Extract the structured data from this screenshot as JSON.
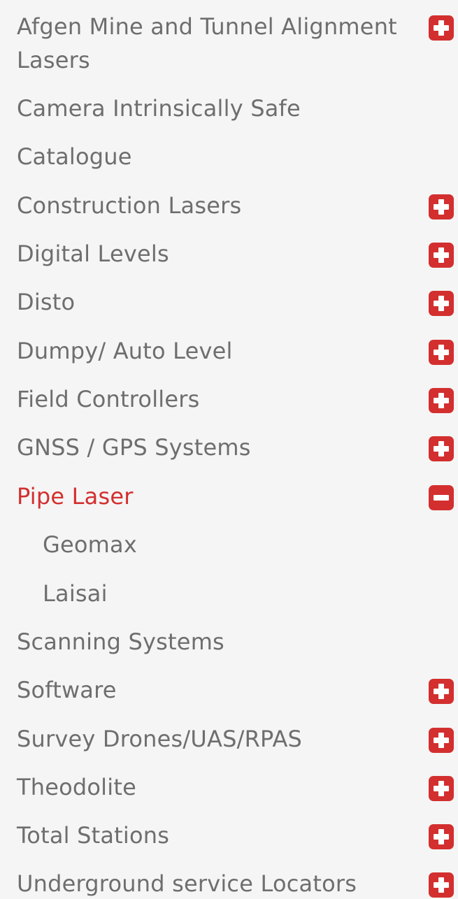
{
  "menu": {
    "items": [
      {
        "label": "Afgen Mine and Tunnel Alignment Lasers",
        "toggle": "expand-icon"
      },
      {
        "label": "Camera Intrinsically Safe",
        "toggle": null
      },
      {
        "label": "Catalogue",
        "toggle": null
      },
      {
        "label": "Construction Lasers",
        "toggle": "expand-icon"
      },
      {
        "label": "Digital Levels",
        "toggle": "expand-icon"
      },
      {
        "label": "Disto",
        "toggle": "expand-icon"
      },
      {
        "label": "Dumpy/ Auto Level",
        "toggle": "expand-icon"
      },
      {
        "label": "Field Controllers",
        "toggle": "expand-icon"
      },
      {
        "label": "GNSS / GPS Systems",
        "toggle": "expand-icon"
      },
      {
        "label": "Pipe Laser",
        "toggle": "collapse-icon",
        "active": true,
        "children": [
          {
            "label": "Geomax"
          },
          {
            "label": "Laisai"
          }
        ]
      },
      {
        "label": "Scanning Systems",
        "toggle": null
      },
      {
        "label": "Software",
        "toggle": "expand-icon"
      },
      {
        "label": "Survey Drones/UAS/RPAS",
        "toggle": "expand-icon"
      },
      {
        "label": "Theodolite",
        "toggle": "expand-icon"
      },
      {
        "label": "Total Stations",
        "toggle": "expand-icon"
      },
      {
        "label": "Underground service Locators",
        "toggle": "expand-icon"
      }
    ]
  },
  "colors": {
    "accent": "#d32f2f",
    "text": "#6e6e6e",
    "background": "#f5f5f5"
  }
}
